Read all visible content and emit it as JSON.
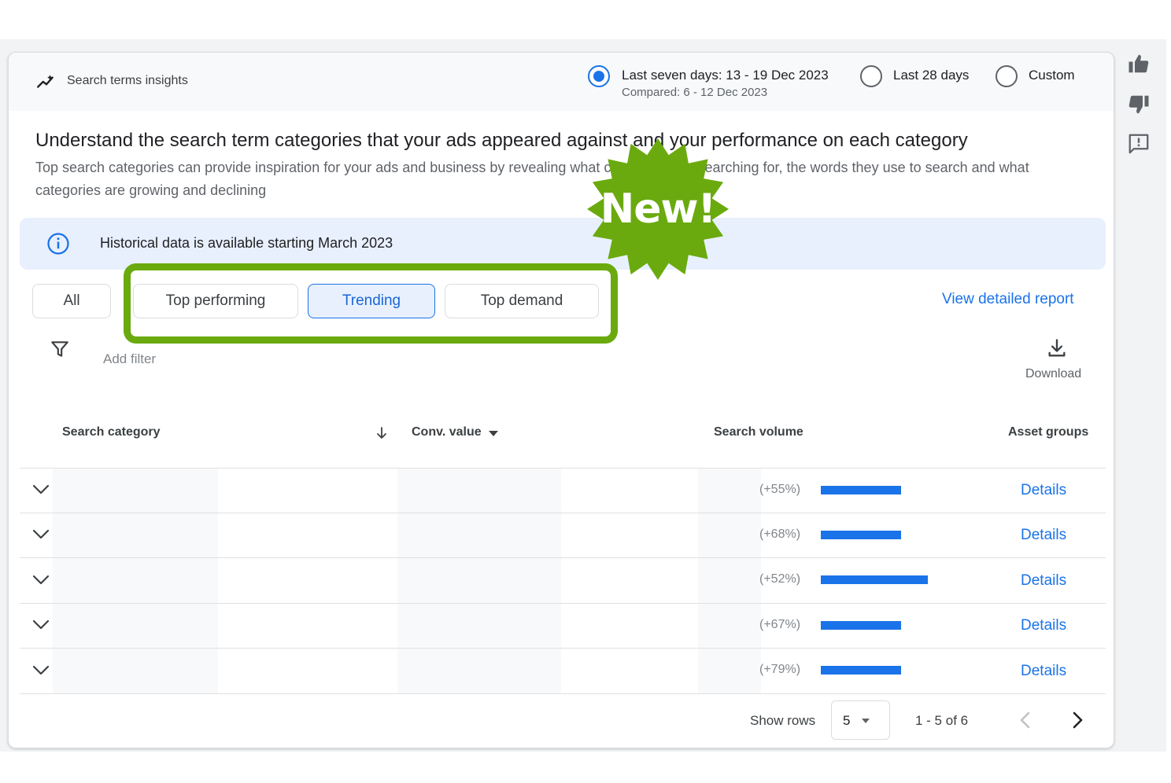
{
  "header": {
    "title": "Search terms insights",
    "date_options": [
      {
        "label": "Last seven days: 13 - 19 Dec 2023",
        "sub": "Compared: 6 - 12 Dec 2023",
        "selected": true
      },
      {
        "label": "Last 28 days",
        "selected": false
      },
      {
        "label": "Custom",
        "selected": false
      }
    ]
  },
  "intro": {
    "headline": "Understand the search term categories that your ads appeared against and your performance on each category",
    "description": "Top search categories can provide inspiration for your ads and business by revealing what customers are searching for, the words they use to search and what categories are growing and declining"
  },
  "banner": {
    "text": "Historical data is available starting March 2023",
    "icon": "info-icon"
  },
  "tabs": [
    {
      "label": "All",
      "selected": false
    },
    {
      "label": "Top performing",
      "selected": false
    },
    {
      "label": "Trending",
      "selected": true
    },
    {
      "label": "Top demand",
      "selected": false
    }
  ],
  "badge": {
    "text": "New!",
    "color": "#6aaa0e"
  },
  "highlight_color": "#6aaa0e",
  "view_report": "View detailed report",
  "filter": {
    "label": "Add filter",
    "icon": "filter-icon"
  },
  "download": {
    "label": "Download",
    "icon": "download-icon"
  },
  "table": {
    "columns": [
      "Search category",
      "Conv. value",
      "Search volume",
      "Asset groups"
    ],
    "rows": [
      {
        "change": "(+55%)",
        "volume": 0.75,
        "action": "Details"
      },
      {
        "change": "(+68%)",
        "volume": 0.75,
        "action": "Details"
      },
      {
        "change": "(+52%)",
        "volume": 1.0,
        "action": "Details"
      },
      {
        "change": "(+67%)",
        "volume": 0.75,
        "action": "Details"
      },
      {
        "change": "(+79%)",
        "volume": 0.75,
        "action": "Details"
      }
    ]
  },
  "pagination": {
    "show_rows_label": "Show rows",
    "rows_value": "5",
    "range": "1 - 5 of 6"
  },
  "side_icons": [
    "thumbs-up-icon",
    "thumbs-down-icon",
    "feedback-icon"
  ],
  "colors": {
    "accent": "#1a73e8",
    "selected_chip_bg": "#e8f0fe",
    "banner_bg": "#e8f0fe"
  }
}
